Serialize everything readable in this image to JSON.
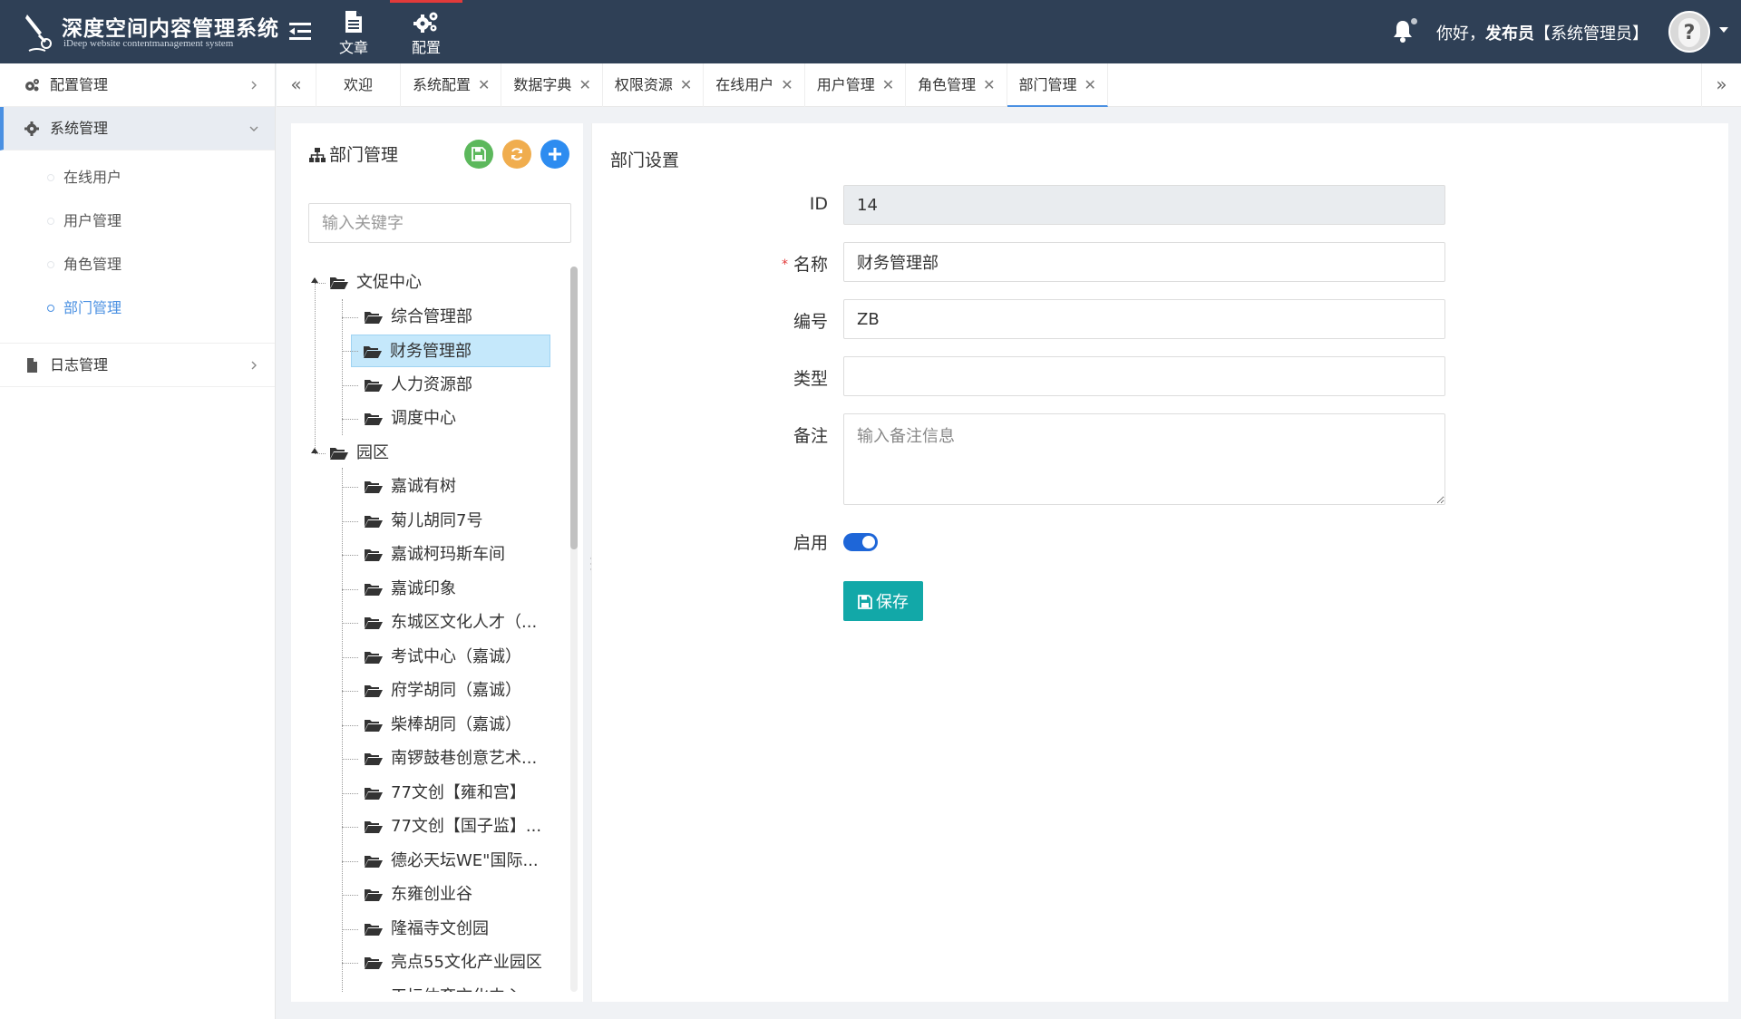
{
  "app": {
    "title": "深度空间内容管理系统",
    "subtitle": "iDeep website contentmanagement system"
  },
  "top_nav": [
    {
      "label": "文章",
      "icon": "document-icon"
    },
    {
      "label": "配置",
      "icon": "gears-icon",
      "active": true
    }
  ],
  "user": {
    "greeting_prefix": "你好，",
    "name": "发布员",
    "role": "【系统管理员】"
  },
  "sidebar": {
    "groups": [
      {
        "label": "配置管理",
        "icon": "gears-icon"
      },
      {
        "label": "系统管理",
        "icon": "gear-icon",
        "open": true
      },
      {
        "label": "日志管理",
        "icon": "file-icon"
      }
    ],
    "sub_items": [
      "在线用户",
      "用户管理",
      "角色管理",
      "部门管理"
    ],
    "active_sub": "部门管理"
  },
  "tabs": [
    {
      "label": "欢迎",
      "closable": false
    },
    {
      "label": "系统配置",
      "closable": true
    },
    {
      "label": "数据字典",
      "closable": true
    },
    {
      "label": "权限资源",
      "closable": true
    },
    {
      "label": "在线用户",
      "closable": true
    },
    {
      "label": "用户管理",
      "closable": true
    },
    {
      "label": "角色管理",
      "closable": true
    },
    {
      "label": "部门管理",
      "closable": true,
      "active": true
    }
  ],
  "tree_panel": {
    "title": "部门管理",
    "search_placeholder": "输入关键字",
    "roots": [
      {
        "label": "文促中心",
        "children": [
          "综合管理部",
          "财务管理部",
          "人力资源部",
          "调度中心"
        ]
      },
      {
        "label": "园区",
        "children": [
          "嘉诚有树",
          "菊儿胡同7号",
          "嘉诚柯玛斯车间",
          "嘉诚印象",
          "东城区文化人才（...",
          "考试中心（嘉诚）",
          "府学胡同（嘉诚）",
          "柴棒胡同（嘉诚）",
          "南锣鼓巷创意艺术...",
          "77文创【雍和宫】",
          "77文创【国子监】...",
          "德必天坛WE\"国际...",
          "东雍创业谷",
          "隆福寺文创园",
          "亮点55文化产业园区",
          "天坛体育文化中心"
        ]
      }
    ],
    "selected": "财务管理部"
  },
  "form": {
    "title": "部门设置",
    "fields": {
      "id": {
        "label": "ID",
        "value": "14"
      },
      "name": {
        "label": "名称",
        "value": "财务管理部",
        "required": true
      },
      "code": {
        "label": "编号",
        "value": "ZB"
      },
      "type": {
        "label": "类型",
        "value": ""
      },
      "remark": {
        "label": "备注",
        "placeholder": "输入备注信息"
      },
      "enabled": {
        "label": "启用",
        "value": true
      }
    },
    "save_label": "保存"
  },
  "colors": {
    "header_bg": "#2f4056",
    "accent": "#4a90e2",
    "save_btn": "#12a8a8",
    "btn_save_tree": "#5cb85c",
    "btn_refresh": "#f0ad4e",
    "btn_add": "#2d8cf0",
    "selected_node": "#c5e8fb"
  }
}
